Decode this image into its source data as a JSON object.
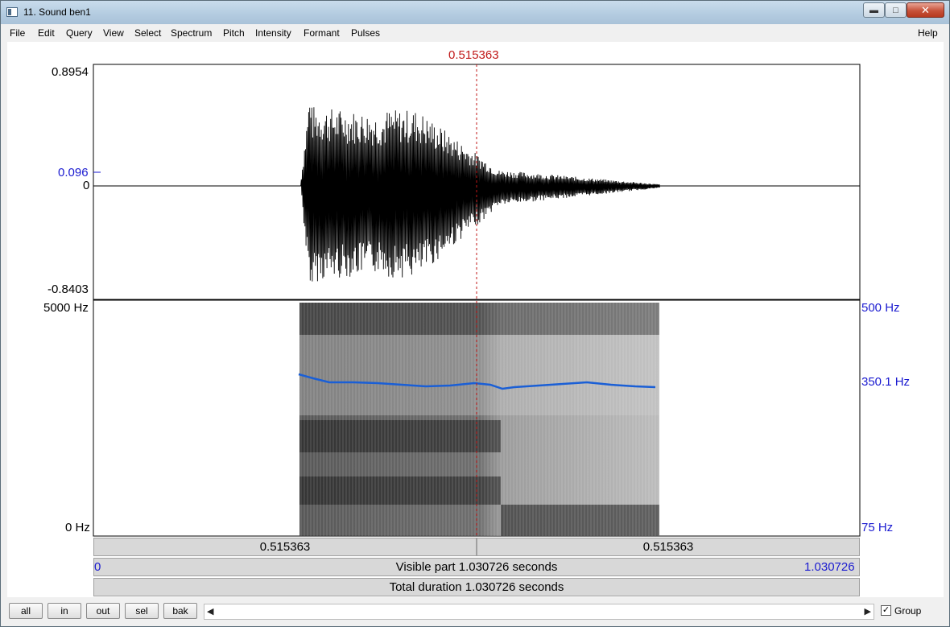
{
  "window": {
    "title": "11. Sound ben1"
  },
  "titlebar": {
    "minimize_icon": "minimize-icon",
    "maximize_icon": "maximize-icon",
    "close_icon": "close-icon"
  },
  "menu": {
    "items": [
      "File",
      "Edit",
      "Query",
      "View",
      "Select",
      "Spectrum",
      "Pitch",
      "Intensity",
      "Formant",
      "Pulses"
    ],
    "help": "Help"
  },
  "cursor": {
    "time_label": "0.515363"
  },
  "waveform": {
    "ymax": "0.8954",
    "ymin": "-0.8403",
    "zero": "0",
    "cursor_value": "0.096"
  },
  "spectrogram": {
    "freq_max": "5000 Hz",
    "freq_min": "0 Hz",
    "pitch_max": "500 Hz",
    "pitch_value": "350.1 Hz",
    "pitch_min": "75 Hz"
  },
  "bars": {
    "left_segment": "0.515363",
    "right_segment": "0.515363",
    "visible_start": "0",
    "visible_label": "Visible part 1.030726 seconds",
    "visible_end": "1.030726",
    "total_label": "Total duration 1.030726 seconds"
  },
  "bottom": {
    "buttons": [
      "all",
      "in",
      "out",
      "sel",
      "bak"
    ],
    "group_label": "Group",
    "group_checked": true,
    "scroll_left_icon": "triangle-left-icon",
    "scroll_right_icon": "triangle-right-icon"
  },
  "colors": {
    "waveform": "#000000",
    "cursor": "#c01818",
    "pitch_line": "#1a5fd6",
    "axis_blue": "#1a1ad0"
  }
}
